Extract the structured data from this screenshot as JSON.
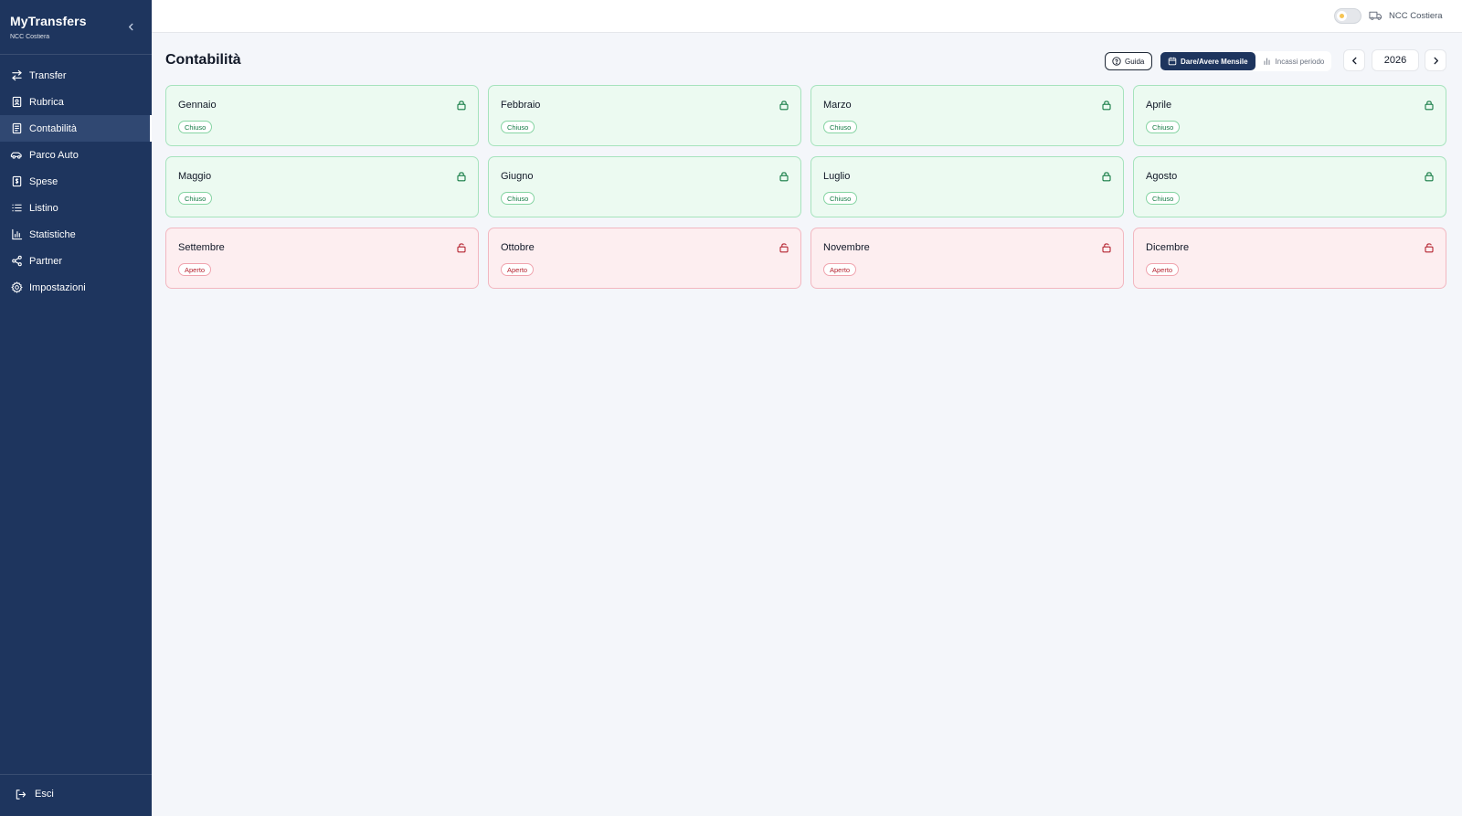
{
  "app": {
    "title": "MyTransfers",
    "subtitle": "NCC Costiera"
  },
  "sidebar": {
    "items": [
      {
        "label": "Transfer",
        "icon": "arrows-left-right-icon",
        "active": false
      },
      {
        "label": "Rubrica",
        "icon": "contact-book-icon",
        "active": false
      },
      {
        "label": "Contabilità",
        "icon": "ledger-icon",
        "active": true
      },
      {
        "label": "Parco Auto",
        "icon": "car-icon",
        "active": false
      },
      {
        "label": "Spese",
        "icon": "dollar-receipt-icon",
        "active": false
      },
      {
        "label": "Listino",
        "icon": "list-icon",
        "active": false
      },
      {
        "label": "Statistiche",
        "icon": "bar-chart-icon",
        "active": false
      },
      {
        "label": "Partner",
        "icon": "share-icon",
        "active": false
      },
      {
        "label": "Impostazioni",
        "icon": "gear-icon",
        "active": false
      }
    ],
    "logout_label": "Esci"
  },
  "topbar": {
    "company": "NCC Costiera"
  },
  "main": {
    "title": "Contabilità",
    "guide_label": "Guida",
    "views": [
      {
        "label": "Dare/Avere Mensile",
        "active": true
      },
      {
        "label": "Incassi periodo",
        "active": false
      }
    ],
    "year": "2026",
    "months": [
      {
        "name": "Gennaio",
        "status": "Chiuso"
      },
      {
        "name": "Febbraio",
        "status": "Chiuso"
      },
      {
        "name": "Marzo",
        "status": "Chiuso"
      },
      {
        "name": "Aprile",
        "status": "Chiuso"
      },
      {
        "name": "Maggio",
        "status": "Chiuso"
      },
      {
        "name": "Giugno",
        "status": "Chiuso"
      },
      {
        "name": "Luglio",
        "status": "Chiuso"
      },
      {
        "name": "Agosto",
        "status": "Chiuso"
      },
      {
        "name": "Settembre",
        "status": "Aperto"
      },
      {
        "name": "Ottobre",
        "status": "Aperto"
      },
      {
        "name": "Novembre",
        "status": "Aperto"
      },
      {
        "name": "Dicembre",
        "status": "Aperto"
      }
    ]
  },
  "colors": {
    "sidebar_bg": "#1e355e",
    "closed_bg": "#ecfaf1",
    "closed_border": "#a6e3bd",
    "closed_text": "#137a43",
    "open_bg": "#fdeef0",
    "open_border": "#f2b7c0",
    "open_text": "#b4232f"
  }
}
